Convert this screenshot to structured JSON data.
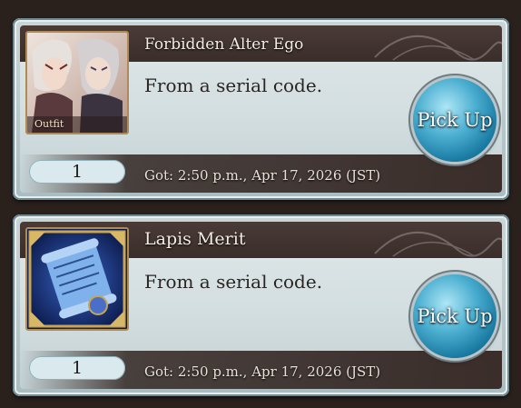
{
  "items": [
    {
      "name": "Forbidden Alter Ego",
      "description": "From a serial code.",
      "quantity": "1",
      "received": "Got: 2:50 p.m., Apr 17, 2026 (JST)",
      "button_label": "Pick Up",
      "thumbnail_badge": "Outfit",
      "icon": "outfit-portrait-icon"
    },
    {
      "name": "Lapis Merit",
      "description": "From a serial code.",
      "quantity": "1",
      "received": "Got: 2:50 p.m., Apr 17, 2026 (JST)",
      "button_label": "Pick Up",
      "icon": "scroll-item-icon"
    }
  ],
  "colors": {
    "background": "#2a211d",
    "card_frame": "#c9d6d8",
    "title_bar": "#3a2d2a",
    "pick_button": "#4aaed0"
  }
}
